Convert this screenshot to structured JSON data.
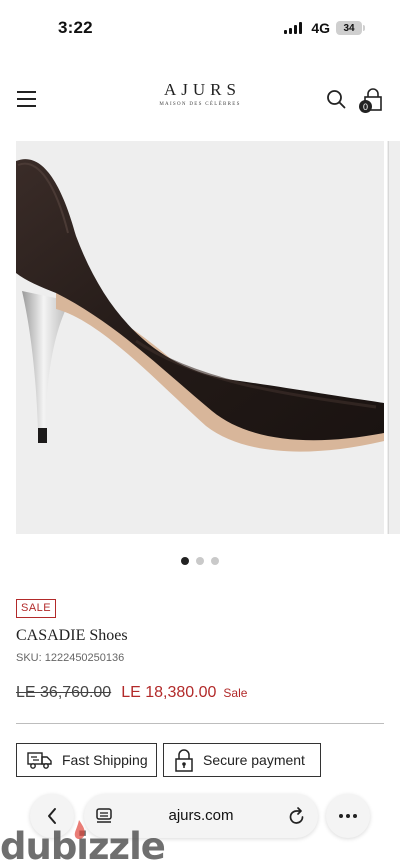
{
  "status_bar": {
    "time": "3:22",
    "network": "4G",
    "battery": "34"
  },
  "header": {
    "logo_title": "AJURS",
    "logo_subtitle": "MAISON DES CÉLÈBRES",
    "cart_count": "0"
  },
  "gallery": {
    "image_subject": "black pointed-toe stiletto pump with silver blade heel",
    "dot_count": 3,
    "active_dot": 0
  },
  "product": {
    "badge": "SALE",
    "title": "CASADIE Shoes",
    "sku": "SKU: 1222450250136",
    "original_price": "LE 36,760.00",
    "sale_price": "LE 18,380.00",
    "sale_label": "Sale"
  },
  "features": {
    "shipping": "Fast Shipping",
    "payment": "Secure payment"
  },
  "browser": {
    "url": "ajurs.com"
  },
  "watermark": {
    "text": "dubizzle"
  },
  "colors": {
    "accent_sale": "#b22a2a",
    "text_primary": "#222222",
    "image_background": "#eeeeee"
  }
}
